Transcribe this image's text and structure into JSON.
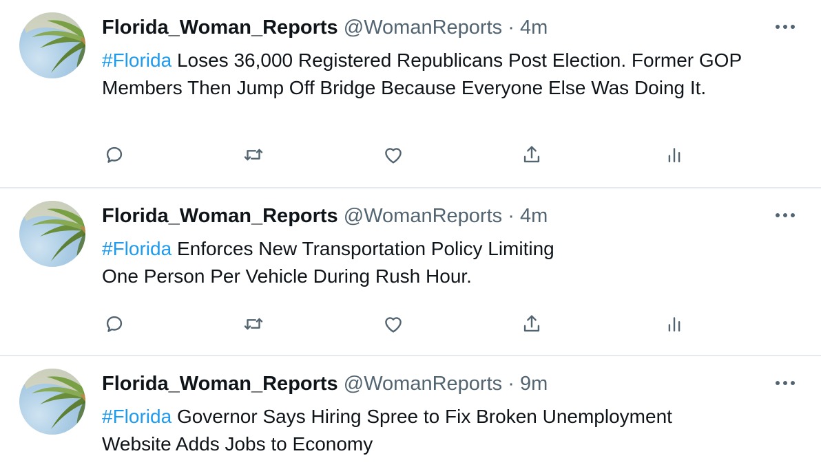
{
  "colors": {
    "accent": "#1d9bf0",
    "text_primary": "#0f1419",
    "text_secondary": "#536471",
    "divider": "#e6e9ec"
  },
  "tweets": [
    {
      "name": "Florida_Woman_Reports",
      "handle": "@WomanReports",
      "separator": "·",
      "time": "4m",
      "hashtag": "#Florida",
      "body": " Loses 36,000 Registered Republicans Post  Election. Former GOP Members Then Jump Off Bridge Because Everyone Else Was Doing It."
    },
    {
      "name": "Florida_Woman_Reports",
      "handle": "@WomanReports",
      "separator": "·",
      "time": "4m",
      "hashtag": "#Florida",
      "body_line1": " Enforces New Transportation Policy Limiting",
      "body_line2": "One Person Per Vehicle During Rush Hour."
    },
    {
      "name": "Florida_Woman_Reports",
      "handle": "@WomanReports",
      "separator": "·",
      "time": "9m",
      "hashtag": "#Florida",
      "body_line1": " Governor Says Hiring Spree to Fix Broken Unemployment",
      "body_line2": "Website Adds Jobs to Economy"
    }
  ],
  "icons": {
    "avatar": "palm-tree-sky-avatar",
    "more": "more-dots-icon",
    "reply": "reply-bubble-icon",
    "retweet": "retweet-icon",
    "like": "heart-icon",
    "share": "share-upload-icon",
    "analytics": "analytics-bars-icon"
  }
}
